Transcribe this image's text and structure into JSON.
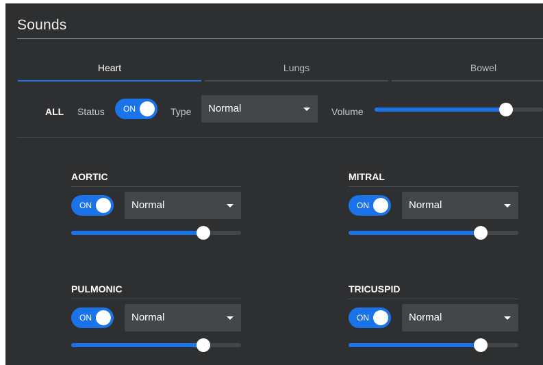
{
  "panel": {
    "title": "Sounds"
  },
  "tabs": [
    {
      "label": "Heart",
      "active": true
    },
    {
      "label": "Lungs",
      "active": false
    },
    {
      "label": "Bowel",
      "active": false
    }
  ],
  "all": {
    "label": "ALL",
    "status_label": "Status",
    "status_toggle": "ON",
    "type_label": "Type",
    "type_value": "Normal",
    "volume_label": "Volume",
    "volume_level": 0.78
  },
  "valves": [
    {
      "label": "AORTIC",
      "toggle": "ON",
      "type": "Normal",
      "volume_level": 0.78
    },
    {
      "label": "MITRAL",
      "toggle": "ON",
      "type": "Normal",
      "volume_level": 0.78
    },
    {
      "label": "PULMONIC",
      "toggle": "ON",
      "type": "Normal",
      "volume_level": 0.78
    },
    {
      "label": "TRICUSPID",
      "toggle": "ON",
      "type": "Normal",
      "volume_level": 0.78
    }
  ],
  "colors": {
    "panel_bg": "#2d2f31",
    "accent": "#1a73e8",
    "control_bg": "#44474a"
  }
}
